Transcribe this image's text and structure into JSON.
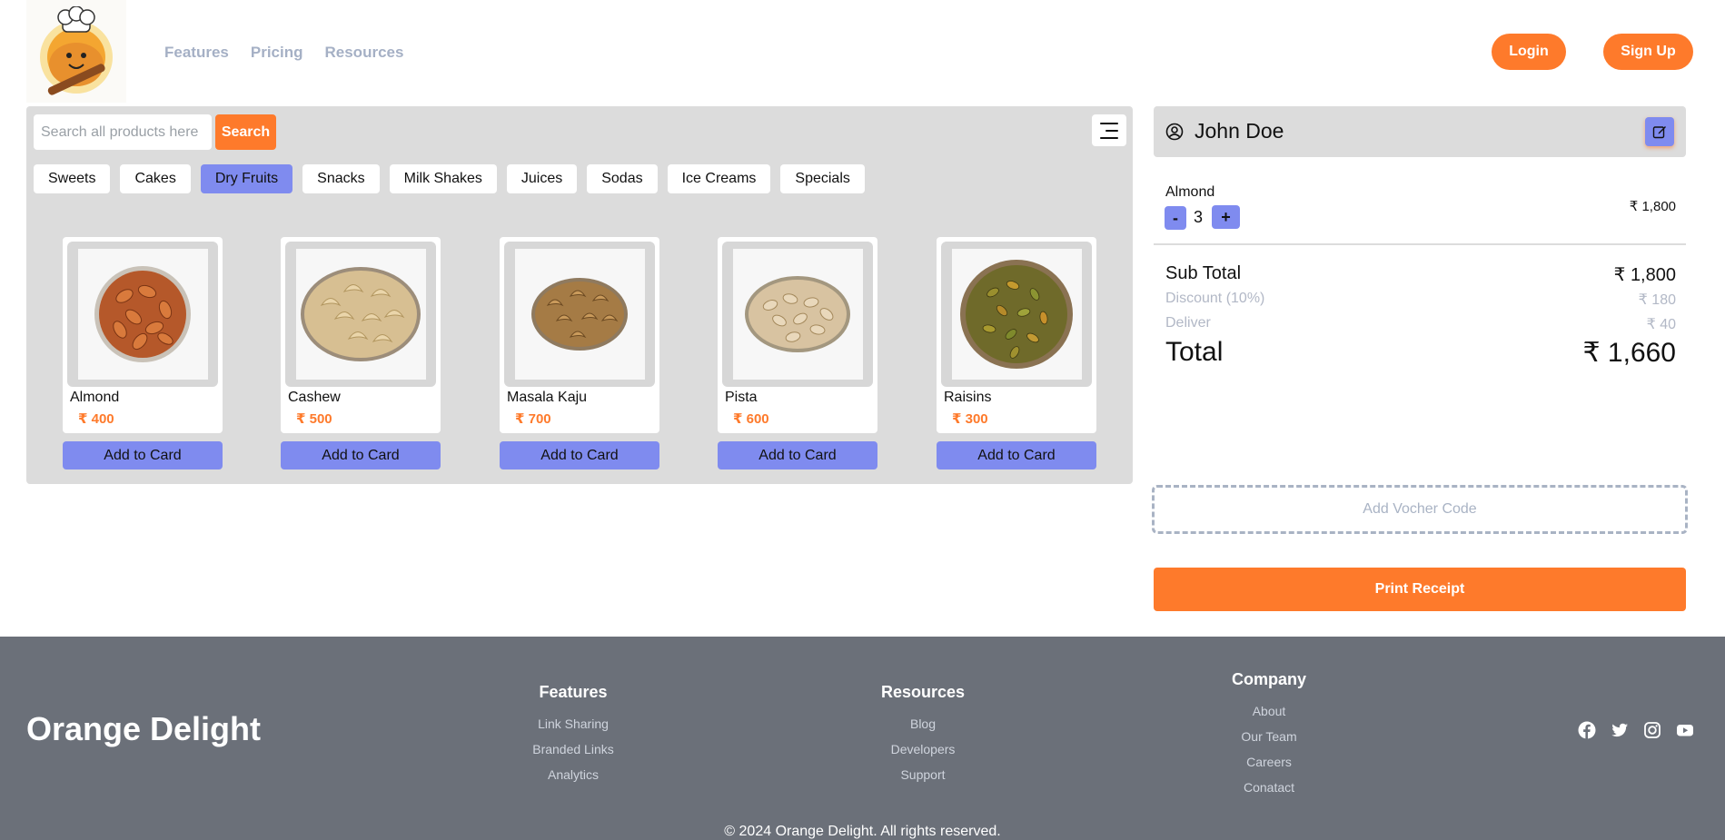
{
  "header": {
    "nav": [
      "Features",
      "Pricing",
      "Resources"
    ],
    "login_label": "Login",
    "signup_label": "Sign Up"
  },
  "search": {
    "placeholder": "Search all products here",
    "button_label": "Search"
  },
  "categories": [
    "Sweets",
    "Cakes",
    "Dry Fruits",
    "Snacks",
    "Milk Shakes",
    "Juices",
    "Sodas",
    "Ice Creams",
    "Specials"
  ],
  "active_category": "Dry Fruits",
  "products": [
    {
      "name": "Almond",
      "price": "₹ 400",
      "button": "Add to Card"
    },
    {
      "name": "Cashew",
      "price": "₹ 500",
      "button": "Add to Card"
    },
    {
      "name": "Masala Kaju",
      "price": "₹ 700",
      "button": "Add to Card"
    },
    {
      "name": "Pista",
      "price": "₹ 600",
      "button": "Add to Card"
    },
    {
      "name": "Raisins",
      "price": "₹ 300",
      "button": "Add to Card"
    }
  ],
  "cart": {
    "customer": "John Doe",
    "items": [
      {
        "name": "Almond",
        "qty": "3",
        "price": "₹ 1,800",
        "minus": "-",
        "plus": "+"
      }
    ],
    "subtotal_label": "Sub Total",
    "subtotal": "₹ 1,800",
    "discount_label": "Discount (10%)",
    "discount": "₹ 180",
    "delivery_label": "Deliver",
    "delivery": "₹ 40",
    "total_label": "Total",
    "total": "₹ 1,660",
    "voucher_label": "Add Vocher Code",
    "print_label": "Print Receipt"
  },
  "footer": {
    "brand": "Orange Delight",
    "columns": [
      {
        "heading": "Features",
        "links": [
          "Link Sharing",
          "Branded Links",
          "Analytics"
        ]
      },
      {
        "heading": "Resources",
        "links": [
          "Blog",
          "Developers",
          "Support"
        ]
      },
      {
        "heading": "Company",
        "links": [
          "About",
          "Our Team",
          "Careers",
          "Conatact"
        ]
      }
    ],
    "socials": [
      "facebook-icon",
      "twitter-icon",
      "instagram-icon",
      "youtube-icon"
    ],
    "copyright": "© 2024 Orange Delight. All rights reserved."
  },
  "colors": {
    "accent_orange": "#fe7a2b",
    "accent_purple": "#7f8bef",
    "panel_gray": "#dcdcdc",
    "footer_gray": "#6b7079"
  }
}
